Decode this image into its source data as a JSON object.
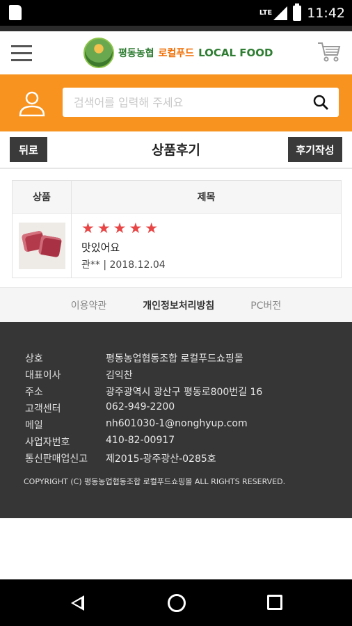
{
  "status_bar": {
    "network": "LTE",
    "time": "11:42"
  },
  "header": {
    "logo_text_kr1": "평동농협",
    "logo_text_kr2": "로컬푸드",
    "logo_text_en": "LOCAL FOOD"
  },
  "search": {
    "placeholder": "검색어를 입력해 주세요"
  },
  "titlebar": {
    "back_label": "뒤로",
    "title": "상품후기",
    "write_label": "후기작성"
  },
  "reviews": {
    "col_product": "상품",
    "col_title": "제목",
    "items": [
      {
        "stars": "★★★★★",
        "rating": 5,
        "title": "맛있어요",
        "author_date": "관** | 2018.12.04"
      }
    ]
  },
  "footer_links": [
    "이용약관",
    "개인정보처리방침",
    "PC버전"
  ],
  "company_info": [
    {
      "label": "상호",
      "value": "평동농업협동조합 로컬푸드쇼핑몰"
    },
    {
      "label": "대표이사",
      "value": "김익찬"
    },
    {
      "label": "주소",
      "value": "광주광역시 광산구 평동로800번길 16"
    },
    {
      "label": "고객센터",
      "value": "062-949-2200"
    },
    {
      "label": "메일",
      "value": "nh601030-1@nonghyup.com"
    },
    {
      "label": "사업자번호",
      "value": "410-82-00917"
    },
    {
      "label": "통신판매업신고",
      "value": "제2015-광주광산-0285호"
    }
  ],
  "copyright": "COPYRIGHT (C) 평동농업협동조합 로컬푸드쇼핑몰 ALL RIGHTS RESERVED.",
  "colors": {
    "accent_orange": "#f7931e",
    "footer_bg": "#363636",
    "star_red": "#e84646"
  }
}
